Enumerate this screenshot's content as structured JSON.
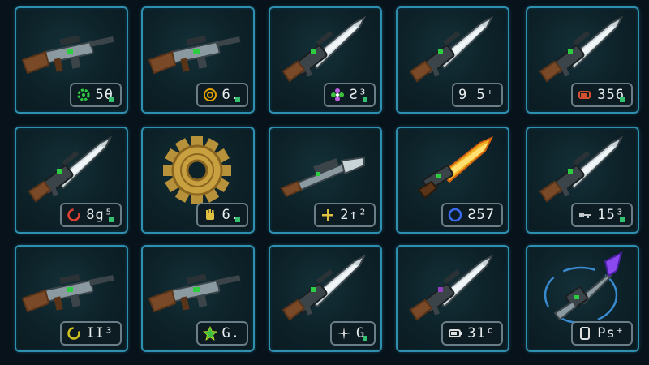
{
  "inventory": {
    "slots": [
      {
        "name": "rifle-wood-stock",
        "kind": "rifle",
        "accent": "#2ecc40",
        "badge": {
          "icon": "gear-icon",
          "icon_color": "#2ecc40",
          "value": "5θ"
        },
        "pip": true
      },
      {
        "name": "rifle-compact",
        "kind": "rifle",
        "accent": "#2ecc40",
        "badge": {
          "icon": "target-icon",
          "icon_color": "#e0a000",
          "value": "6."
        },
        "pip": true
      },
      {
        "name": "blade-rifle-scoped",
        "kind": "bladegun",
        "accent": "#2ecc40",
        "badge": {
          "icon": "flower-icon",
          "icon_color": "#c060e0",
          "value": "Ƨ³"
        },
        "pip": true
      },
      {
        "name": "rifle-bayonet",
        "kind": "bladegun",
        "accent": "#2ecc40",
        "badge": {
          "icon": "",
          "icon_color": "#ffffff",
          "value": "9 5⁺"
        },
        "pip": false
      },
      {
        "name": "sword-rifle-long",
        "kind": "bladegun",
        "accent": "#2ecc40",
        "badge": {
          "icon": "battery-icon",
          "icon_color": "#d05030",
          "value": "356"
        },
        "pip": true
      },
      {
        "name": "blade-rifle-serrated",
        "kind": "bladegun",
        "accent": "#2ecc40",
        "badge": {
          "icon": "ring-icon",
          "icon_color": "#e04030",
          "value": "8g⁵"
        },
        "pip": true
      },
      {
        "name": "bronze-gear",
        "kind": "gear",
        "accent": "#c9a040",
        "badge": {
          "icon": "fist-icon",
          "icon_color": "#e0c040",
          "value": "6."
        },
        "pip": true
      },
      {
        "name": "drill-rifle",
        "kind": "drill",
        "accent": "#2ecc40",
        "badge": {
          "icon": "cross-icon",
          "icon_color": "#e0c040",
          "value": "2↑²"
        },
        "pip": false
      },
      {
        "name": "flame-sword-rifle",
        "kind": "flame",
        "accent": "#2ecc40",
        "badge": {
          "icon": "circle-icon",
          "icon_color": "#3a6cf0",
          "value": "Ƨ57"
        },
        "pip": false
      },
      {
        "name": "saw-rifle",
        "kind": "bladegun",
        "accent": "#2ecc40",
        "badge": {
          "icon": "key-icon",
          "icon_color": "#c0c8cc",
          "value": "15³"
        },
        "pip": true
      },
      {
        "name": "carbine-long",
        "kind": "rifle",
        "accent": "#2ecc40",
        "badge": {
          "icon": "ring-icon",
          "icon_color": "#d0c020",
          "value": "ΙΙ³"
        },
        "pip": false
      },
      {
        "name": "carbine-compact",
        "kind": "rifle",
        "accent": "#2ecc40",
        "badge": {
          "icon": "star-icon",
          "icon_color": "#40c040",
          "value": "G."
        },
        "pip": false
      },
      {
        "name": "blood-blade-rifle",
        "kind": "bladegun",
        "accent": "#2ecc40",
        "badge": {
          "icon": "sparkle-icon",
          "icon_color": "#e0e0e0",
          "value": "G"
        },
        "pip": true
      },
      {
        "name": "lance-rifle",
        "kind": "bladegun",
        "accent": "#9040c0",
        "badge": {
          "icon": "battery-icon",
          "icon_color": "#e0e0e0",
          "value": "31ᶜ"
        },
        "pip": false
      },
      {
        "name": "crystal-lance",
        "kind": "lance",
        "accent": "#8a4af0",
        "badge": {
          "icon": "bracket-icon",
          "icon_color": "#e0e0e0",
          "value": "Ps⁺"
        },
        "pip": false
      }
    ]
  }
}
